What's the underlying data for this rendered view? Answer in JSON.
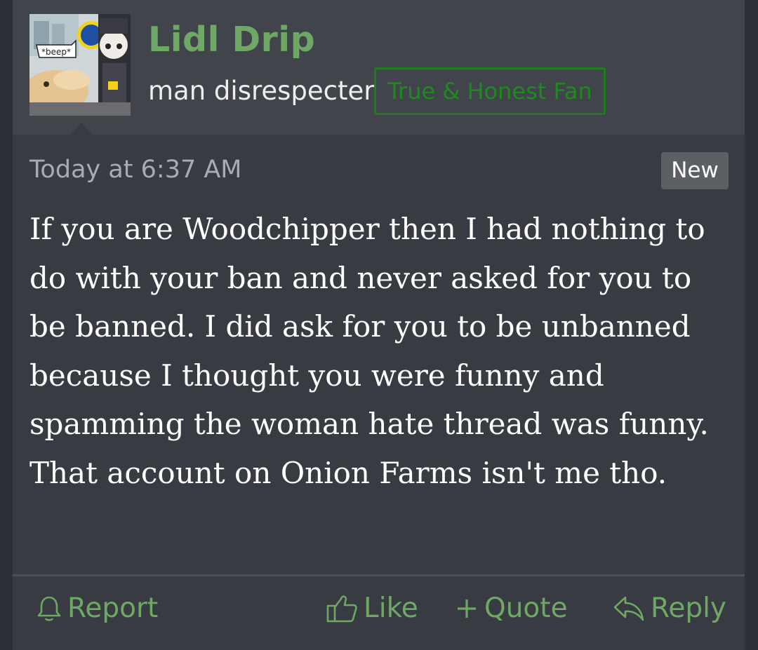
{
  "post": {
    "author": {
      "name": "Lidl Drip",
      "title": "man disrespecter",
      "banner": "True & Honest Fan",
      "avatar_caption": "*beep*"
    },
    "timestamp": "Today at 6:37 AM",
    "badge": "New",
    "message": "If you are Woodchipper then I had nothing to do with your ban and never asked for you to be banned. I did ask for you to be unbanned because I thought you were funny and spamming the woman hate thread was funny. That account on Onion Farms isn't me tho.",
    "actions": {
      "report": "Report",
      "like": "Like",
      "quote": "Quote",
      "reply": "Reply"
    }
  },
  "icons": {
    "report": "bell-icon",
    "like": "thumbs-up-icon",
    "quote": "plus-icon",
    "reply": "reply-arrow-icon"
  },
  "colors": {
    "accent_green": "#6fa764",
    "banner_green": "#1e8a1e",
    "post_background": "#383b42",
    "header_background": "#41444b",
    "text": "#ffffff",
    "muted_text": "#a8abb0"
  }
}
